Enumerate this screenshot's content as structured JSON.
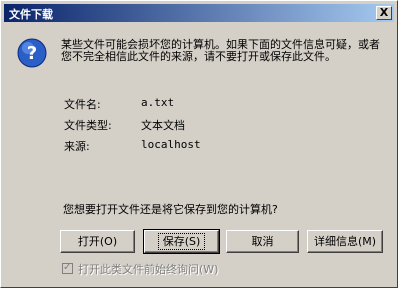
{
  "window": {
    "title": "文件下载",
    "close_symbol": "X"
  },
  "message": "某些文件可能会损坏您的计算机。如果下面的文件信息可疑，或者您不完全相信此文件的来源，请不要打开或保存此文件。",
  "file_info": {
    "name_label": "文件名:",
    "name_value": "a.txt",
    "type_label": "文件类型:",
    "type_value": "文本文档",
    "source_label": "来源:",
    "source_value": "localhost"
  },
  "question": "您想要打开文件还是将它保存到您的计算机?",
  "buttons": {
    "open": "打开(O)",
    "save": "保存(S)",
    "cancel": "取消",
    "details": "详细信息(M)"
  },
  "checkbox": {
    "label": "打开此类文件前始终询问(W)",
    "checked": true,
    "check_mark": "✓"
  }
}
